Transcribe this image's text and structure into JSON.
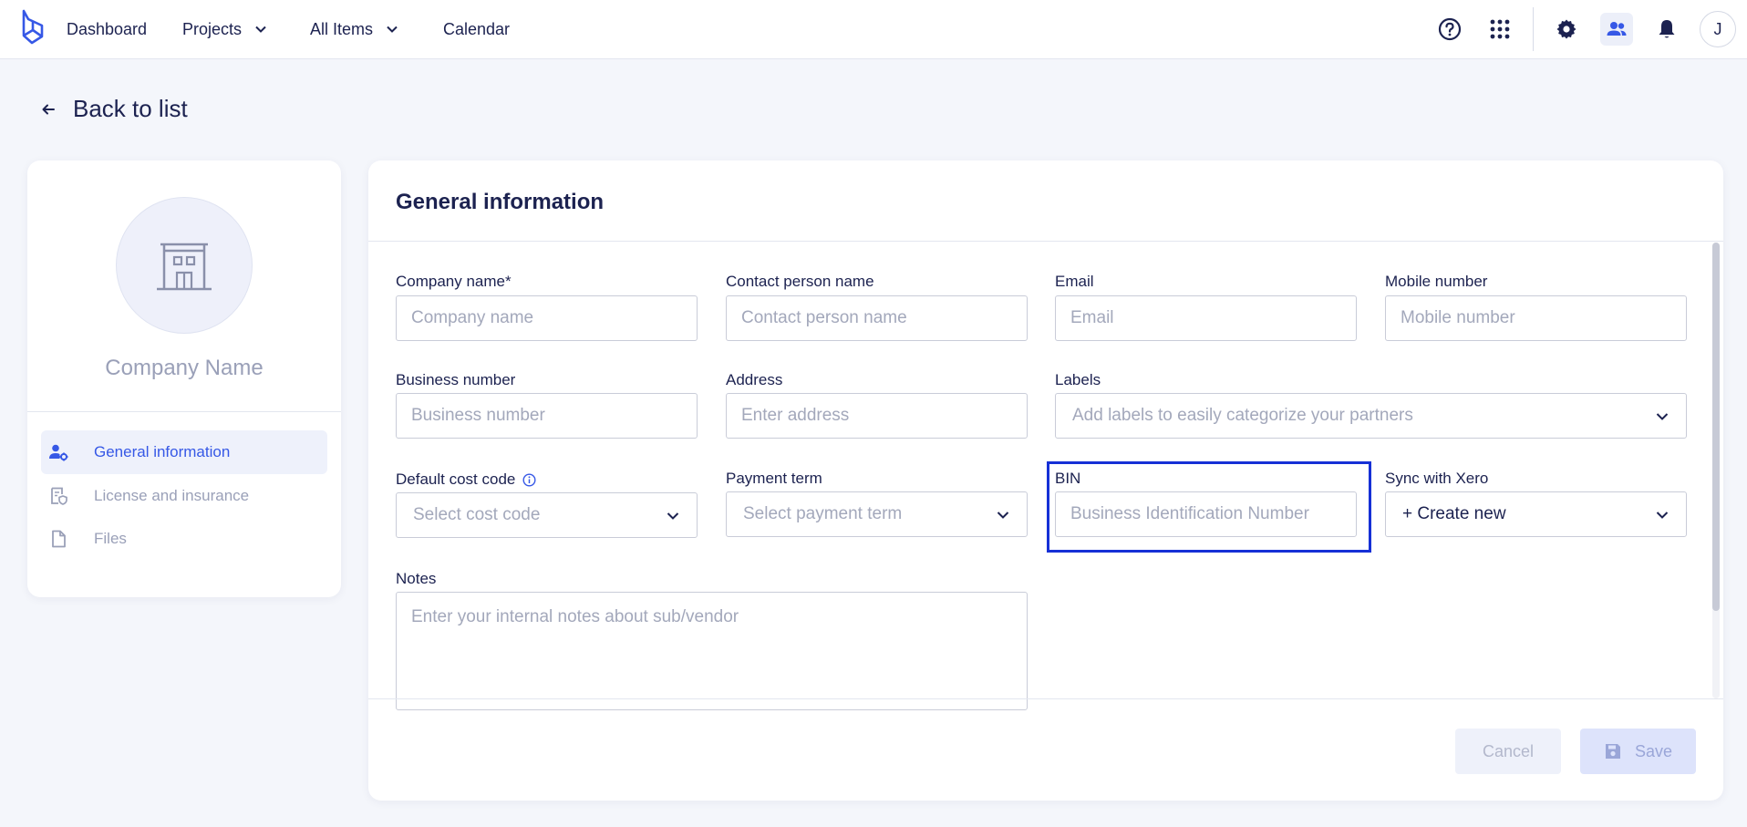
{
  "nav": {
    "items": [
      {
        "label": "Dashboard"
      },
      {
        "label": "Projects"
      },
      {
        "label": "All Items"
      },
      {
        "label": "Calendar"
      }
    ],
    "avatar_initial": "J",
    "icons": [
      "help-icon",
      "apps-grid-icon",
      "settings-icon",
      "users-icon",
      "bell-icon"
    ]
  },
  "back": {
    "label": "Back to list"
  },
  "profile": {
    "company_name": "Company Name",
    "menu": [
      {
        "label": "General information",
        "active": true
      },
      {
        "label": "License and insurance",
        "active": false
      },
      {
        "label": "Files",
        "active": false
      }
    ]
  },
  "form": {
    "title": "General information",
    "fields": {
      "company_name": {
        "label": "Company name*",
        "placeholder": "Company name",
        "value": ""
      },
      "contact_person": {
        "label": "Contact person name",
        "placeholder": "Contact person name",
        "value": ""
      },
      "email": {
        "label": "Email",
        "placeholder": "Email",
        "value": ""
      },
      "mobile": {
        "label": "Mobile number",
        "placeholder": "Mobile number",
        "value": ""
      },
      "business_number": {
        "label": "Business number",
        "placeholder": "Business number",
        "value": ""
      },
      "address": {
        "label": "Address",
        "placeholder": "Enter address",
        "value": ""
      },
      "labels": {
        "label": "Labels",
        "placeholder": "Add labels to easily categorize your partners"
      },
      "cost_code": {
        "label": "Default cost code",
        "placeholder": "Select cost code"
      },
      "payment_term": {
        "label": "Payment term",
        "placeholder": "Select payment term"
      },
      "bin": {
        "label": "BIN",
        "placeholder": "Business Identification Number",
        "value": ""
      },
      "xero": {
        "label": "Sync with Xero",
        "value": "+ Create new"
      },
      "notes": {
        "label": "Notes",
        "placeholder": "Enter your internal notes about sub/vendor",
        "value": ""
      }
    },
    "cancel_label": "Cancel",
    "save_label": "Save"
  },
  "colors": {
    "accent": "#3658e6",
    "highlight": "#1630d6",
    "text": "#1c2250",
    "muted": "#9aa0b8",
    "background": "#f4f6fb"
  }
}
